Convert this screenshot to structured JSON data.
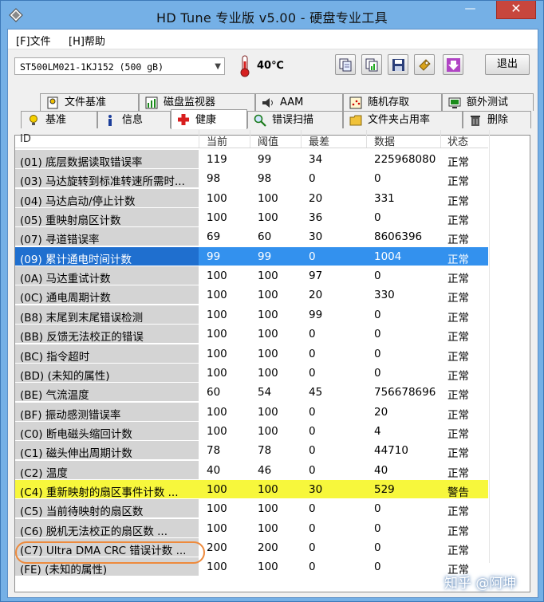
{
  "window": {
    "title": "HD Tune 专业版 v5.00 - 硬盘专业工具",
    "minimize_label": "—",
    "maximize_label": "▢",
    "close_label": "✕"
  },
  "menu": [
    {
      "label": "[F]文件"
    },
    {
      "label": "[H]帮助"
    }
  ],
  "toolbar": {
    "drive": "ST500LM021-1KJ152 (500 gB)",
    "temperature": "40℃",
    "exit_label": "退出"
  },
  "tabs_top": [
    {
      "label": "文件基准",
      "icon": "document-icon"
    },
    {
      "label": "磁盘监视器",
      "icon": "chart-icon"
    },
    {
      "label": "AAM",
      "icon": "speaker-icon"
    },
    {
      "label": "随机存取",
      "icon": "scatter-icon"
    },
    {
      "label": "额外测试",
      "icon": "monitor-icon"
    }
  ],
  "tabs_bottom": [
    {
      "label": "基准",
      "icon": "bulb-icon"
    },
    {
      "label": "信息",
      "icon": "info-icon"
    },
    {
      "label": "健康",
      "icon": "health-cross-icon",
      "active": true
    },
    {
      "label": "错误扫描",
      "icon": "magnifier-icon"
    },
    {
      "label": "文件夹占用率",
      "icon": "folder-icon"
    },
    {
      "label": "删除",
      "icon": "trash-icon"
    }
  ],
  "table": {
    "columns": [
      "ID",
      "当前",
      "阈值",
      "最差",
      "数据",
      "状态"
    ],
    "rows": [
      {
        "id": "(01) 底层数据读取错误率",
        "cur": "119",
        "thr": "99",
        "worst": "34",
        "data": "225968080",
        "status": "正常"
      },
      {
        "id": "(03) 马达旋转到标准转速所需时...",
        "cur": "98",
        "thr": "98",
        "worst": "0",
        "data": "0",
        "status": "正常"
      },
      {
        "id": "(04) 马达启动/停止计数",
        "cur": "100",
        "thr": "100",
        "worst": "20",
        "data": "331",
        "status": "正常"
      },
      {
        "id": "(05) 重映射扇区计数",
        "cur": "100",
        "thr": "100",
        "worst": "36",
        "data": "0",
        "status": "正常"
      },
      {
        "id": "(07) 寻道错误率",
        "cur": "69",
        "thr": "60",
        "worst": "30",
        "data": "8606396",
        "status": "正常"
      },
      {
        "id": "(09) 累计通电时间计数",
        "cur": "99",
        "thr": "99",
        "worst": "0",
        "data": "1004",
        "status": "正常",
        "selected": true
      },
      {
        "id": "(0A) 马达重试计数",
        "cur": "100",
        "thr": "100",
        "worst": "97",
        "data": "0",
        "status": "正常"
      },
      {
        "id": "(0C) 通电周期计数",
        "cur": "100",
        "thr": "100",
        "worst": "20",
        "data": "330",
        "status": "正常"
      },
      {
        "id": "(B8) 末尾到末尾错误检测",
        "cur": "100",
        "thr": "100",
        "worst": "99",
        "data": "0",
        "status": "正常"
      },
      {
        "id": "(BB) 反馈无法校正的错误",
        "cur": "100",
        "thr": "100",
        "worst": "0",
        "data": "0",
        "status": "正常"
      },
      {
        "id": "(BC) 指令超时",
        "cur": "100",
        "thr": "100",
        "worst": "0",
        "data": "0",
        "status": "正常"
      },
      {
        "id": "(BD) (未知的属性)",
        "cur": "100",
        "thr": "100",
        "worst": "0",
        "data": "0",
        "status": "正常"
      },
      {
        "id": "(BE) 气流温度",
        "cur": "60",
        "thr": "54",
        "worst": "45",
        "data": "756678696",
        "status": "正常"
      },
      {
        "id": "(BF) 振动感测错误率",
        "cur": "100",
        "thr": "100",
        "worst": "0",
        "data": "20",
        "status": "正常"
      },
      {
        "id": "(C0) 断电磁头缩回计数",
        "cur": "100",
        "thr": "100",
        "worst": "0",
        "data": "4",
        "status": "正常"
      },
      {
        "id": "(C1) 磁头伸出周期计数",
        "cur": "78",
        "thr": "78",
        "worst": "0",
        "data": "44710",
        "status": "正常"
      },
      {
        "id": "(C2) 温度",
        "cur": "40",
        "thr": "46",
        "worst": "0",
        "data": "40",
        "status": "正常"
      },
      {
        "id": "(C4) 重新映射的扇区事件计数 ...",
        "cur": "100",
        "thr": "100",
        "worst": "30",
        "data": "529",
        "status": "警告",
        "warning": true
      },
      {
        "id": "(C5) 当前待映射的扇区数",
        "cur": "100",
        "thr": "100",
        "worst": "0",
        "data": "0",
        "status": "正常"
      },
      {
        "id": "(C6) 脱机无法校正的扇区数 ...",
        "cur": "100",
        "thr": "100",
        "worst": "0",
        "data": "0",
        "status": "正常"
      },
      {
        "id": "(C7) Ultra DMA CRC 错误计数 ...",
        "cur": "200",
        "thr": "200",
        "worst": "0",
        "data": "0",
        "status": "正常",
        "circled": true
      },
      {
        "id": "(FE) (未知的属性)",
        "cur": "100",
        "thr": "100",
        "worst": "0",
        "data": "0",
        "status": "正常"
      }
    ]
  },
  "watermark": "知乎 @阿坤",
  "colors": {
    "selected_row": "#3391ee",
    "warning_row": "#f7f73c",
    "circle_annotation": "#ee8a3c",
    "window_border": "#75b0e6"
  }
}
